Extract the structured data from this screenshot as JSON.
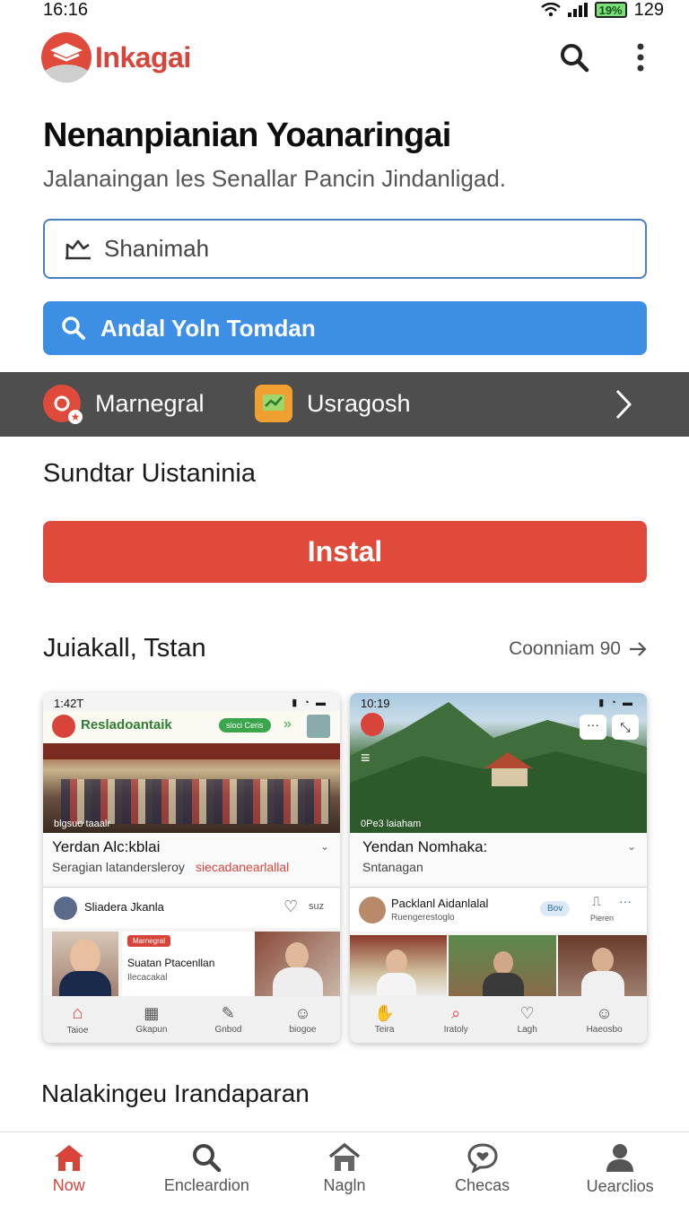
{
  "status": {
    "time": "16:16",
    "battery": "19%",
    "right_num": "129"
  },
  "app": {
    "name": "Inkagai"
  },
  "header": {
    "title": "Nenanpianian Yoanaringai",
    "subtitle": "Jalanaingan les Senallar Pancin Jindanligad."
  },
  "input": {
    "value": "Shanimah"
  },
  "search_button": {
    "label": "Andal Yoln Tomdan"
  },
  "graybar": {
    "item1": "Marnegral",
    "item2": "Usragosh"
  },
  "section1": {
    "title": "Sundtar Uistaninia"
  },
  "install": {
    "label": "Instal"
  },
  "section2": {
    "title": "Juiakall, Tstan",
    "see_all": "Coonniam 90"
  },
  "card1": {
    "time": "1:42T",
    "app_title": "Resladoantaik",
    "pill": "sloci Ceris",
    "photo_caption": "blgsuo taaalr",
    "title": "Yerdan Alc:kblai",
    "subtitle_a": "Seragian latandersleroy",
    "subtitle_b": "siecadanearlallal",
    "user": "Sliadera Jkanla",
    "action_label": "suz",
    "badge": "Marnegral",
    "person_name": "Suatan Ptacenllan",
    "person_sub": "Ilecacakal",
    "nav": [
      "Taioe",
      "Gkapun",
      "Gnbod",
      "biogoe"
    ]
  },
  "card2": {
    "time": "10:19",
    "photo_caption": "0Pe3 laiaham",
    "title": "Yendan Nomhaka:",
    "subtitle": "Sntanagan",
    "user": "Packlanl Aidanlalal",
    "user_sub": "Ruengerestoglo",
    "pill": "Bov",
    "action_label": "Pieren",
    "nav": [
      "Teira",
      "Iratoly",
      "Lagh",
      "Haeosbo"
    ]
  },
  "section3": {
    "title": "Nalakingeu Irandaparan"
  },
  "bottom_nav": [
    {
      "label": "Now"
    },
    {
      "label": "Encleardion"
    },
    {
      "label": "Nagln"
    },
    {
      "label": "Checas"
    },
    {
      "label": "Uearclios"
    }
  ],
  "colors": {
    "accent": "#d9443a",
    "primary_blue": "#3d8fe6",
    "graybar": "#4e4e4e"
  }
}
